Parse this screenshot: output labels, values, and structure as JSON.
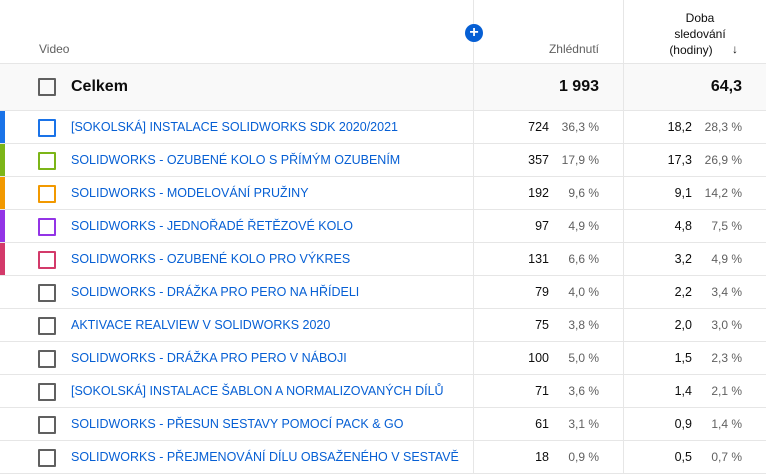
{
  "header": {
    "video_label": "Video",
    "views_label": "Zhlédnutí",
    "watch_label_1": "Doba",
    "watch_label_2": "sledování",
    "watch_label_3": "(hodiny)",
    "add_icon": "plus-icon",
    "sort_icon": "arrow-down-icon"
  },
  "total": {
    "label": "Celkem",
    "views": "1 993",
    "watch": "64,3"
  },
  "rows": [
    {
      "title": "[SOKOLSKÁ] INSTALACE SOLIDWORKS SDK 2020/2021",
      "views": "724",
      "views_pct": "36,3 %",
      "watch": "18,2",
      "watch_pct": "28,3 %",
      "color": "#1a73e8"
    },
    {
      "title": "SOLIDWORKS - OZUBENÉ KOLO S PŘÍMÝM OZUBENÍM",
      "views": "357",
      "views_pct": "17,9 %",
      "watch": "17,3",
      "watch_pct": "26,9 %",
      "color": "#7cb518"
    },
    {
      "title": "SOLIDWORKS - MODELOVÁNÍ PRUŽINY",
      "views": "192",
      "views_pct": "9,6 %",
      "watch": "9,1",
      "watch_pct": "14,2 %",
      "color": "#f29900"
    },
    {
      "title": "SOLIDWORKS - JEDNOŘADÉ ŘETĚZOVÉ KOLO",
      "views": "97",
      "views_pct": "4,9 %",
      "watch": "4,8",
      "watch_pct": "7,5 %",
      "color": "#9334e6"
    },
    {
      "title": "SOLIDWORKS - OZUBENÉ KOLO PRO VÝKRES",
      "views": "131",
      "views_pct": "6,6 %",
      "watch": "3,2",
      "watch_pct": "4,9 %",
      "color": "#d33a6a"
    },
    {
      "title": "SOLIDWORKS - DRÁŽKA PRO PERO NA HŘÍDELI",
      "views": "79",
      "views_pct": "4,0 %",
      "watch": "2,2",
      "watch_pct": "3,4 %",
      "color": ""
    },
    {
      "title": "AKTIVACE REALVIEW V SOLIDWORKS 2020",
      "views": "75",
      "views_pct": "3,8 %",
      "watch": "2,0",
      "watch_pct": "3,0 %",
      "color": ""
    },
    {
      "title": "SOLIDWORKS - DRÁŽKA PRO PERO V NÁBOJI",
      "views": "100",
      "views_pct": "5,0 %",
      "watch": "1,5",
      "watch_pct": "2,3 %",
      "color": ""
    },
    {
      "title": "[SOKOLSKÁ] INSTALACE ŠABLON A NORMALIZOVANÝCH DÍLŮ",
      "views": "71",
      "views_pct": "3,6 %",
      "watch": "1,4",
      "watch_pct": "2,1 %",
      "color": ""
    },
    {
      "title": "SOLIDWORKS - PŘESUN SESTAVY POMOCÍ PACK & GO",
      "views": "61",
      "views_pct": "3,1 %",
      "watch": "0,9",
      "watch_pct": "1,4 %",
      "color": ""
    },
    {
      "title": "SOLIDWORKS - PŘEJMENOVÁNÍ DÍLU OBSAŽENÉHO V SESTAVĚ",
      "views": "18",
      "views_pct": "0,9 %",
      "watch": "0,5",
      "watch_pct": "0,7 %",
      "color": ""
    }
  ]
}
